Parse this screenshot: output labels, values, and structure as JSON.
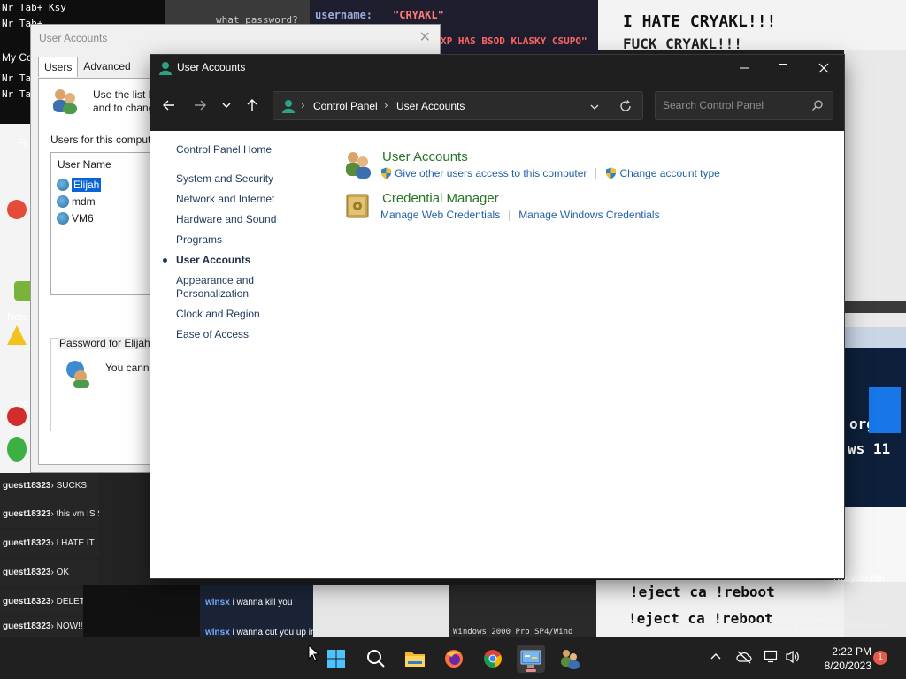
{
  "background": {
    "terminal": {
      "line1": "Nr Tab+ Ksy",
      "line2": "Nr Tab+",
      "line3": "Nr Tab+",
      "line4": "Nr Tab+",
      "username_label": "username:",
      "username_value": "\"CRYAKL\"",
      "password_prompt": "what password?",
      "xp_line": "XP HAS BSOD KLASKY CSUPO\""
    },
    "scrawl1": "I HATE CRYAKL!!!",
    "scrawl2": "FUCK CRYAKL!!!",
    "desktop_labels": {
      "my": "My Co",
      "fir": "Fir",
      "goo": "Goo Gh",
      "note": "Note",
      "und": "Und"
    },
    "chat": [
      {
        "user": "guest18323",
        "msg": "SUCKS"
      },
      {
        "user": "guest18323",
        "msg": "this vm IS SUCKS"
      },
      {
        "user": "guest18323",
        "msg": "I HATE IT"
      },
      {
        "user": "guest18323",
        "msg": "OK"
      },
      {
        "user": "guest18323",
        "msg": "DELETE IT"
      },
      {
        "user": "guest18323",
        "msg": "NOW!!!"
      }
    ],
    "bottom_strip": {
      "wlnsx1": "wlnsx",
      "wlnsx1_msg": "i wanna kill you",
      "wlnsx2": "wlnsx",
      "wlnsx2_msg": "i wanna cut you up int",
      "win2000": "Windows 2000 Pro SP4/Wind",
      "reboot1": "!eject ca !reboot",
      "reboot2": "!eject ca !reboot",
      "recycle": "Recycle Bin",
      "copy": "Evaluation copy. Build 25926 (rs_prerelease) 230707-1532",
      "win11": "ws 11",
      "org": "org"
    }
  },
  "legacy_dialog": {
    "title": "User Accounts",
    "tabs": [
      "Users",
      "Advanced"
    ],
    "intro": "Use the list b and to chang",
    "users_for": "Users for this comput",
    "col_header": "User Name",
    "users": [
      "Elijah",
      "mdm",
      "VM6"
    ],
    "password_for": "Password for Elijah",
    "you_cannot": "You canno"
  },
  "window": {
    "title": "User Accounts",
    "minimize": "—",
    "maximize": "□",
    "close": "✕",
    "breadcrumb": [
      "Control Panel",
      "User Accounts"
    ],
    "search_placeholder": "Search Control Panel",
    "left_nav": {
      "home": "Control Panel Home",
      "items": [
        "System and Security",
        "Network and Internet",
        "Hardware and Sound",
        "Programs",
        "User Accounts",
        "Appearance and Personalization",
        "Clock and Region",
        "Ease of Access"
      ],
      "current_index": 4
    },
    "categories": [
      {
        "title": "User Accounts",
        "links": [
          "Give other users access to this computer",
          "Change account type"
        ]
      },
      {
        "title": "Credential Manager",
        "links": [
          "Manage Web Credentials",
          "Manage Windows Credentials"
        ]
      }
    ]
  },
  "taskbar": {
    "time": "2:22 PM",
    "date": "8/20/2023",
    "notification_count": "1"
  },
  "colors": {
    "category_title": "#267326",
    "link": "#1e5fa8",
    "titlebar": "#1f1f1f",
    "taskbar": "#202020"
  }
}
